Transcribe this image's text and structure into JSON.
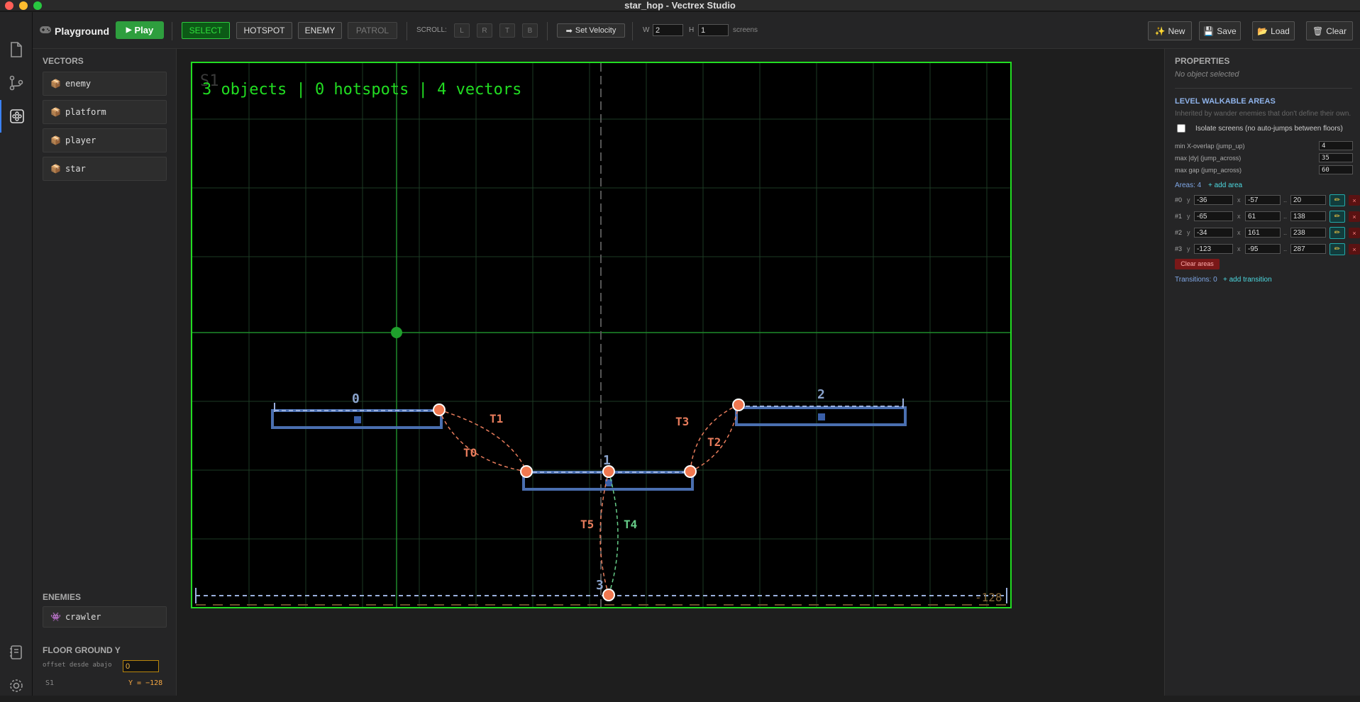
{
  "window": {
    "title": "star_hop - Vectrex Studio"
  },
  "toolbar": {
    "app_name": "Playground",
    "play": "Play",
    "modes": [
      "SELECT",
      "HOTSPOT",
      "ENEMY",
      "PATROL"
    ],
    "scroll_label": "SCROLL:",
    "scroll_buttons": [
      "L",
      "R",
      "T",
      "B"
    ],
    "set_velocity": "Set Velocity",
    "w_label": "W",
    "w_value": "2",
    "h_label": "H",
    "h_value": "1",
    "screens_label": "screens",
    "new": "New",
    "save": "Save",
    "load": "Load",
    "clear": "Clear"
  },
  "left": {
    "vectors_title": "VECTORS",
    "vectors": [
      "enemy",
      "platform",
      "player",
      "star"
    ],
    "enemies_title": "ENEMIES",
    "enemies": [
      "crawler"
    ],
    "floor_title": "FLOOR GROUND Y",
    "offset_label": "offset desde abajo",
    "offset_value": "0",
    "screen_label": "S1",
    "y_readout": "Y = −128"
  },
  "canvas": {
    "screen_tag": "S1",
    "stats": "3 objects | 0 hotspots | 4 vectors",
    "bottom_value": "-128",
    "platform_labels": [
      "0",
      "1",
      "2",
      "3"
    ],
    "transitions": [
      "T0",
      "T1",
      "T2",
      "T3",
      "T4",
      "T5"
    ],
    "colors": {
      "green": "#22dd22",
      "platform": "#4a6fb0",
      "node": "#f07850",
      "transition": "#e87c5c",
      "transition_green": "#66cc88"
    }
  },
  "right": {
    "properties_title": "PROPERTIES",
    "no_selection": "No object selected",
    "walk_title": "LEVEL WALKABLE AREAS",
    "walk_desc": "Inherited by wander enemies that don't define their own.",
    "isolate_label": "Isolate screens (no auto-jumps between floors)",
    "params": [
      {
        "label": "min X-overlap (jump_up)",
        "value": "4"
      },
      {
        "label": "max |dy| (jump_across)",
        "value": "35"
      },
      {
        "label": "max gap (jump_across)",
        "value": "60"
      }
    ],
    "areas_label": "Areas: 4",
    "add_area": "+ add area",
    "areas": [
      {
        "id": "#0",
        "y": "-36",
        "x1": "-57",
        "x2": "20"
      },
      {
        "id": "#1",
        "y": "-65",
        "x1": "61",
        "x2": "138"
      },
      {
        "id": "#2",
        "y": "-34",
        "x1": "161",
        "x2": "238"
      },
      {
        "id": "#3",
        "y": "-123",
        "x1": "-95",
        "x2": "287"
      }
    ],
    "y_label": "y",
    "x_label": "x",
    "range_sep": "..",
    "clear_areas": "Clear areas",
    "transitions_label": "Transitions: 0",
    "add_transition": "+ add transition"
  }
}
